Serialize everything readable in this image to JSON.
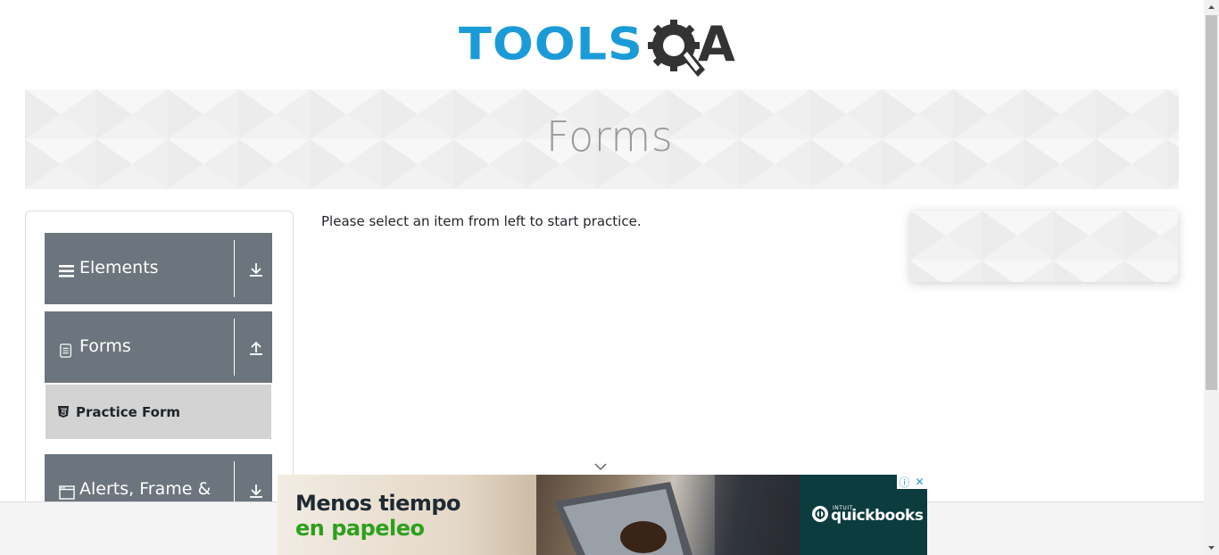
{
  "logo": {
    "part1": "TOOLS",
    "part2": "A",
    "colors": {
      "tools": "#1a9bd8",
      "qa": "#333333"
    },
    "icon": "gear-magnifier-icon"
  },
  "banner": {
    "title": "Forms"
  },
  "sidebar": {
    "groups": [
      {
        "label": "Elements",
        "icon": "hamburger-icon",
        "toggle": "download-arrow-icon"
      },
      {
        "label": "Forms",
        "icon": "document-icon",
        "toggle": "upload-arrow-icon"
      },
      {
        "label": "Alerts, Frame &",
        "icon": "window-icon",
        "toggle": "download-arrow-icon"
      }
    ],
    "sub_items": [
      {
        "label": "Practice Form",
        "icon": "html5-icon"
      }
    ],
    "header_color": "#6c757d",
    "active_item_bg": "#d3d3d3"
  },
  "main": {
    "message": "Please select an item from left to start practice."
  },
  "ad": {
    "headline1": "Menos tiempo",
    "headline2": "en papeleo",
    "brand_small": "INTUIT",
    "brand": "quickbooks",
    "info_icon": "info-icon",
    "close_icon": "close-icon",
    "brand_color": "#2ca01c"
  }
}
